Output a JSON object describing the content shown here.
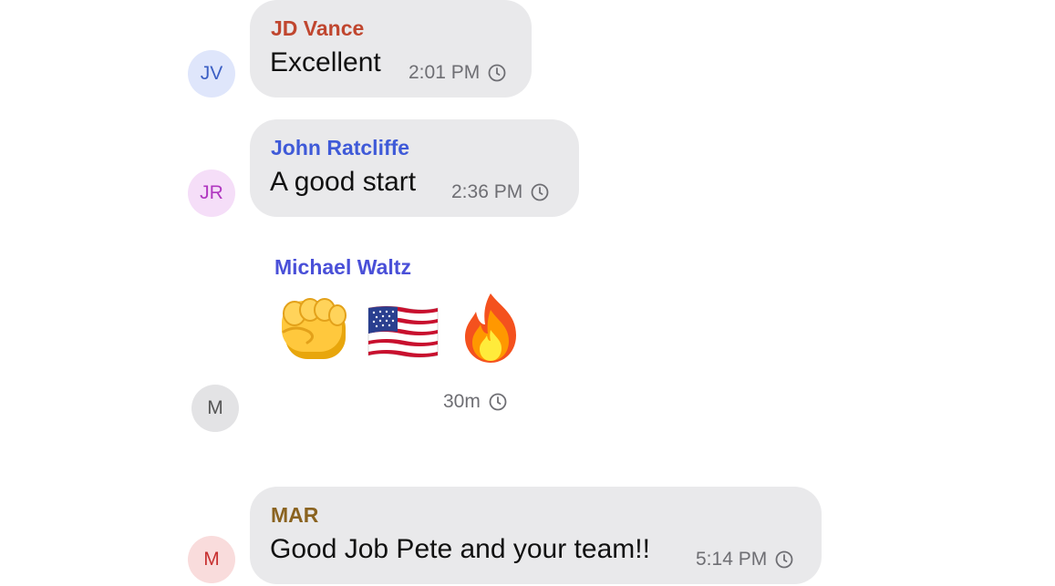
{
  "messages": [
    {
      "avatar_initials": "JV",
      "sender": "JD Vance",
      "text": "Excellent",
      "time": "2:01 PM",
      "status_icon": "clock-icon"
    },
    {
      "avatar_initials": "JR",
      "sender": "John Ratcliffe",
      "text": "A good start",
      "time": "2:36 PM",
      "status_icon": "clock-icon"
    },
    {
      "avatar_initials": "M",
      "sender": "Michael Waltz",
      "emojis": [
        "fist-emoji",
        "us-flag-emoji",
        "fire-emoji"
      ],
      "time": "30m",
      "status_icon": "clock-icon"
    },
    {
      "avatar_initials": "M",
      "sender": "MAR",
      "text": "Good Job Pete and your team!!",
      "time": "5:14 PM",
      "status_icon": "clock-icon"
    }
  ],
  "colors": {
    "bubble": "#e9e9eb",
    "sender_jd": "#c0462f",
    "sender_jr": "#3f5ad8",
    "sender_mw": "#4a50d8",
    "sender_mar": "#8a6320",
    "avatar_jv_bg": "#dfe6fb",
    "avatar_jv_fg": "#3b5fc4",
    "avatar_jr_bg": "#f5def8",
    "avatar_jr_fg": "#b037c0",
    "avatar_m1_bg": "#e3e3e5",
    "avatar_m1_fg": "#555555",
    "avatar_m2_bg": "#f9dcdc",
    "avatar_m2_fg": "#c73030"
  }
}
